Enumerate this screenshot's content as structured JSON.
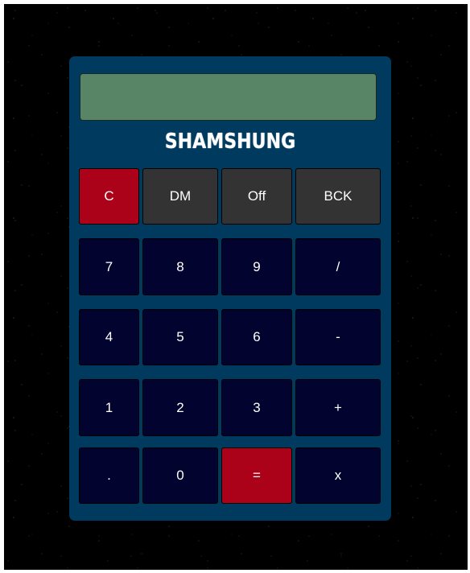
{
  "calculator": {
    "display_value": "",
    "brand": "SHAMSHUNG",
    "rows": [
      [
        {
          "name": "clear-button",
          "label": "C",
          "style": "red"
        },
        {
          "name": "dm-button",
          "label": "DM",
          "style": "grey"
        },
        {
          "name": "off-button",
          "label": "Off",
          "style": "grey"
        },
        {
          "name": "backspace-button",
          "label": "BCK",
          "style": "grey"
        }
      ],
      [
        {
          "name": "digit-7-button",
          "label": "7",
          "style": "num"
        },
        {
          "name": "digit-8-button",
          "label": "8",
          "style": "num"
        },
        {
          "name": "digit-9-button",
          "label": "9",
          "style": "num"
        },
        {
          "name": "divide-button",
          "label": "/",
          "style": "num"
        }
      ],
      [
        {
          "name": "digit-4-button",
          "label": "4",
          "style": "num"
        },
        {
          "name": "digit-5-button",
          "label": "5",
          "style": "num"
        },
        {
          "name": "digit-6-button",
          "label": "6",
          "style": "num"
        },
        {
          "name": "subtract-button",
          "label": "-",
          "style": "num"
        }
      ],
      [
        {
          "name": "digit-1-button",
          "label": "1",
          "style": "num"
        },
        {
          "name": "digit-2-button",
          "label": "2",
          "style": "num"
        },
        {
          "name": "digit-3-button",
          "label": "3",
          "style": "num"
        },
        {
          "name": "add-button",
          "label": "+",
          "style": "num"
        }
      ],
      [
        {
          "name": "decimal-point-button",
          "label": ".",
          "style": "num"
        },
        {
          "name": "digit-0-button",
          "label": "0",
          "style": "num"
        },
        {
          "name": "equals-button",
          "label": "=",
          "style": "red"
        },
        {
          "name": "multiply-button",
          "label": "x",
          "style": "num"
        }
      ]
    ]
  },
  "colors": {
    "body": "#003b5f",
    "display": "#578566",
    "number_key": "#02032e",
    "function_key": "#333333",
    "accent_key": "#ab0219",
    "background": "#000000"
  }
}
